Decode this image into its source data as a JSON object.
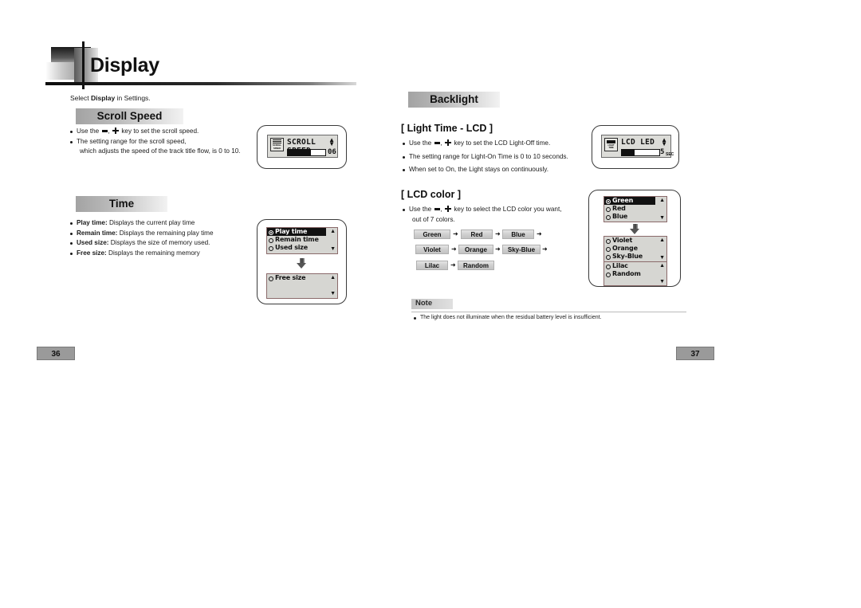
{
  "document": {
    "chapter_title": "Display",
    "intro_prefix": "Select ",
    "intro_bold": "Display",
    "intro_suffix": " in Settings."
  },
  "left_page": {
    "page_number": "36",
    "sections": [
      {
        "title": "Scroll Speed",
        "bullets": [
          {
            "pre": "Use the ",
            "key_minus": true,
            "mid": ", ",
            "key_plus": true,
            "post": " key to set the scroll speed."
          },
          {
            "pre": "The setting range for the scroll speed,",
            "key_minus": false,
            "key_plus": false
          },
          {
            "cont": "which adjusts the speed of the track title flow, is  0 to 10."
          }
        ],
        "device": {
          "type": "slider",
          "icon_label_1": "SCROLL",
          "icon_label_2": "SPEED",
          "title": "SCROLL SPEED",
          "value": "06",
          "fill_percent": 62,
          "unit": ""
        }
      },
      {
        "title": "Time",
        "bullets": [
          {
            "bold": "Play time:",
            "rest": " Displays the current play time"
          },
          {
            "bold": "Remain time:",
            "rest": " Displays the remaining play time"
          },
          {
            "bold": "Used size:",
            "rest": " Displays the size of memory used."
          },
          {
            "bold": "Free size:",
            "rest": " Displays the remaining memory"
          }
        ],
        "device": {
          "type": "menu-2",
          "screen_1": {
            "items": [
              "Play time",
              "Remain time",
              "Used size"
            ],
            "selected_index": 0
          },
          "screen_2": {
            "items": [
              "Free size"
            ],
            "selected_index": -1
          }
        }
      }
    ]
  },
  "right_page": {
    "page_number": "37",
    "section_title": "Backlight",
    "subsections": [
      {
        "heading": "[ Light Time - LCD ]",
        "bullets": [
          {
            "pre": "Use the ",
            "key_minus": true,
            "mid": ", ",
            "key_plus": true,
            "post": " key to set the LCD Light-Off time."
          },
          {
            "pre": "The setting range for Light-On Time is 0 to 10 seconds."
          },
          {
            "pre": "When set to On, the Light stays on continuously."
          }
        ],
        "device": {
          "type": "slider",
          "icon_label_1": "LIGHT",
          "icon_label_2": "TIME",
          "title": "LCD LED",
          "value": "5",
          "unit": "SEC",
          "fill_percent": 34
        }
      },
      {
        "heading": "[ LCD color ]",
        "bullets": [
          {
            "pre": "Use the ",
            "key_minus": true,
            "mid": ", ",
            "key_plus": true,
            "post": " key to select the LCD color you want,"
          },
          {
            "cont": "out of 7 colors."
          }
        ],
        "color_chips": [
          [
            "Green",
            "Red",
            "Blue"
          ],
          [
            "Violet",
            "Orange",
            "Sky-Blue"
          ],
          [
            "Lilac",
            "Random"
          ]
        ],
        "chip_arrow": "➜",
        "device": {
          "type": "menu-3",
          "screen_1": {
            "items": [
              "Green",
              "Red",
              "Blue"
            ],
            "selected_index": 0
          },
          "screen_2": {
            "items": [
              "Violet",
              "Orange",
              "Sky-Blue"
            ],
            "selected_index": -1
          },
          "screen_3": {
            "items": [
              "Lilac",
              "Random"
            ],
            "selected_index": -1
          }
        }
      }
    ],
    "note": {
      "label": "Note",
      "text": "The light does not illuminate when the residual battery level is insufficient."
    }
  }
}
